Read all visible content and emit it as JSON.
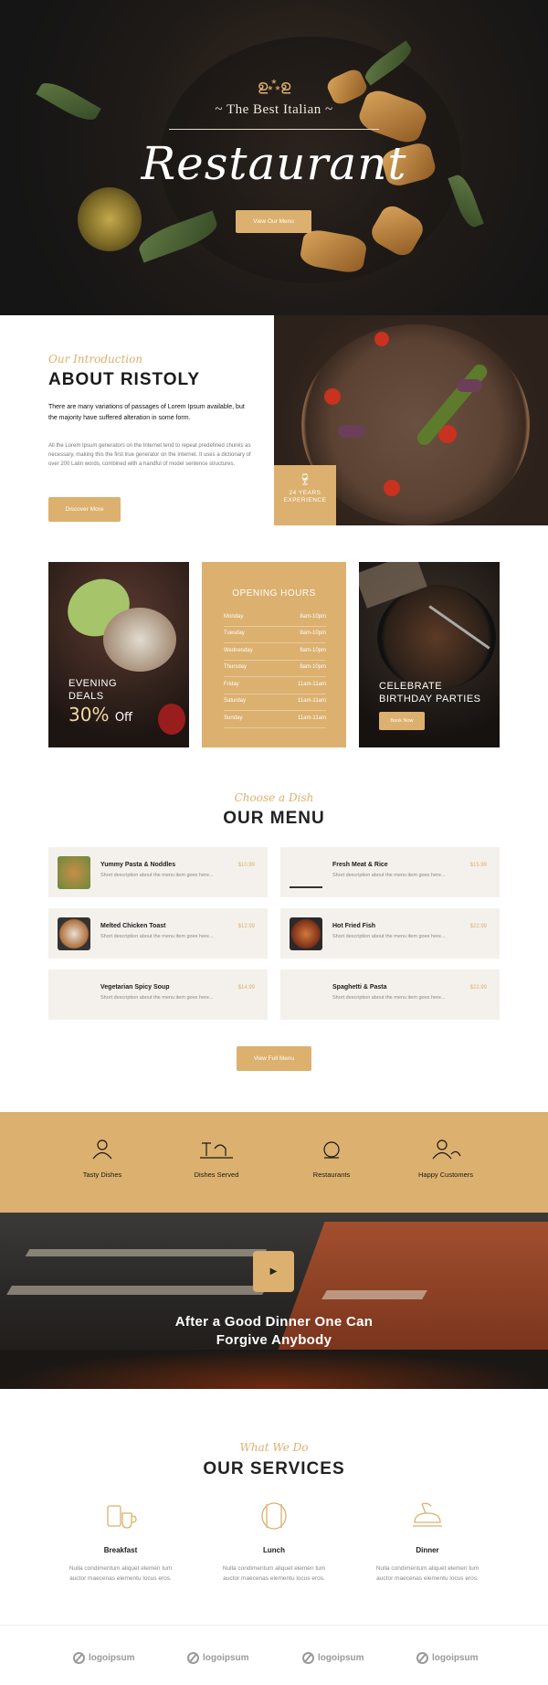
{
  "hero": {
    "ornament": "ഉ⁂ഉ",
    "subtitle": "~ The Best Italian ~",
    "title": "Restaurant",
    "button": "View Our Menu"
  },
  "about": {
    "intro": "Our Introduction",
    "title": "ABOUT RISTOLY",
    "lead": "There are many variations of passages of Lorem Ipsum available, but the majority have suffered alteration in some form.",
    "body": "All the Lorem Ipsum generators on the Internet tend to repeat predefined chunks as necessary, making this the first true generator on the Internet. It uses a dictionary of over 200 Latin words, combined with a handful of model sentence structures.",
    "button": "Discover More",
    "experience_line1": "24 YEARS",
    "experience_line2": "EXPERIENCE"
  },
  "cards": {
    "evening": {
      "line1": "EVENING",
      "line2": "DEALS",
      "offer": "30%",
      "offer_suffix": "Off"
    },
    "hours": {
      "title": "OPENING HOURS",
      "rows": [
        {
          "day": "Monday",
          "time": "8am-10pm"
        },
        {
          "day": "Tuesday",
          "time": "8am-10pm"
        },
        {
          "day": "Wednesday",
          "time": "8am-10pm"
        },
        {
          "day": "Thursday",
          "time": "8am-10pm"
        },
        {
          "day": "Friday",
          "time": "11am-11am"
        },
        {
          "day": "Saturday",
          "time": "11am-11am"
        },
        {
          "day": "Sunday",
          "time": "11am-11am"
        }
      ]
    },
    "birthday": {
      "line1": "CELEBRATE",
      "line2": "BIRTHDAY PARTIES",
      "button": "Book Now"
    }
  },
  "menu": {
    "intro": "Choose a Dish",
    "title": "OUR MENU",
    "items": [
      {
        "name": "Yummy Pasta & Noddles",
        "price": "$10.99",
        "desc": "Short description about the menu item goes here..."
      },
      {
        "name": "Fresh Meat & Rice",
        "price": "$15.99",
        "desc": "Short description about the menu item goes here..."
      },
      {
        "name": "Melted Chicken Toast",
        "price": "$12.99",
        "desc": "Short description about the menu item goes here..."
      },
      {
        "name": "Hot Fried Fish",
        "price": "$22.99",
        "desc": "Short description about the menu item goes here..."
      },
      {
        "name": "Vegetarian Spicy Soup",
        "price": "$14.99",
        "desc": "Short description about the menu item goes here..."
      },
      {
        "name": "Spaghetti & Pasta",
        "price": "$22.99",
        "desc": "Short description about the menu item goes here..."
      }
    ],
    "button": "View Full Menu"
  },
  "stats": [
    {
      "label": "Tasty Dishes",
      "icon": "chef-icon"
    },
    {
      "label": "Dishes Served",
      "icon": "dishes-icon"
    },
    {
      "label": "Restaurants",
      "icon": "cloche-icon"
    },
    {
      "label": "Happy Customers",
      "icon": "customer-icon"
    }
  ],
  "video": {
    "play": "▶",
    "quote_line1": "After a Good Dinner One Can",
    "quote_line2": "Forgive Anybody"
  },
  "services": {
    "intro": "What We Do",
    "title": "OUR SERVICES",
    "items": [
      {
        "title": "Breakfast",
        "line1": "Nulla condimentum aliquet elemen tum",
        "line2": "auctor maecenas elementu locus eros.",
        "icon": "breakfast-icon"
      },
      {
        "title": "Lunch",
        "line1": "Nulla condimentum aliquet elemen tum",
        "line2": "auctor maecenas elementu locus eros.",
        "icon": "lunch-icon"
      },
      {
        "title": "Dinner",
        "line1": "Nulla condimentum aliquet elemen tum",
        "line2": "auctor maecenas elementu locus eros.",
        "icon": "dinner-icon"
      }
    ]
  },
  "logos": [
    "logoipsum",
    "logoipsum",
    "logoipsum",
    "logoipsum"
  ],
  "colors": {
    "accent": "#dcb06e",
    "dark": "#1a1a1a",
    "panel": "#f4f1ec"
  }
}
